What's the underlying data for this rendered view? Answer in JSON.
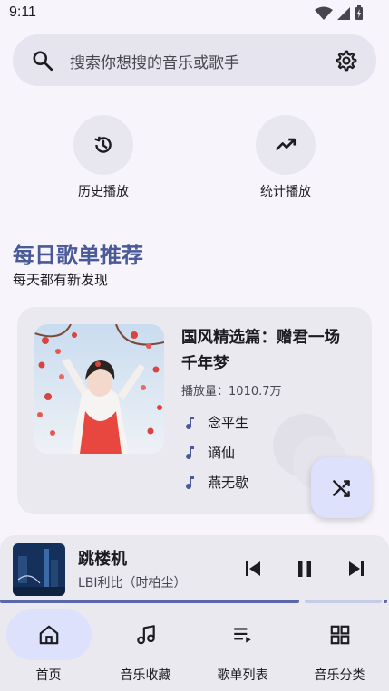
{
  "status_bar": {
    "time": "9:11"
  },
  "search": {
    "placeholder": "搜索你想搜的音乐或歌手"
  },
  "quick_actions": [
    {
      "label": "历史播放",
      "icon": "history-icon"
    },
    {
      "label": "统计播放",
      "icon": "trending-up-icon"
    }
  ],
  "daily": {
    "title": "每日歌单推荐",
    "subtitle": "每天都有新发现",
    "playlist": {
      "title": "国风精选篇：赠君一场千年梦",
      "play_count": "播放量：1010.7万",
      "songs": [
        "念平生",
        "谪仙",
        "燕无歇"
      ]
    }
  },
  "player": {
    "title": "跳楼机",
    "artist": "LBI利比（时柏尘）",
    "progress": 0.77
  },
  "nav": {
    "items": [
      {
        "label": "首页",
        "icon": "home-icon",
        "active": true
      },
      {
        "label": "音乐收藏",
        "icon": "music-note-icon",
        "active": false
      },
      {
        "label": "歌单列表",
        "icon": "queue-music-icon",
        "active": false
      },
      {
        "label": "音乐分类",
        "icon": "category-icon",
        "active": false
      }
    ]
  },
  "colors": {
    "accent": "#4a5a99",
    "background": "#f7f5fb",
    "surface": "#ebe9f0",
    "active_pill": "#dde1fb"
  }
}
